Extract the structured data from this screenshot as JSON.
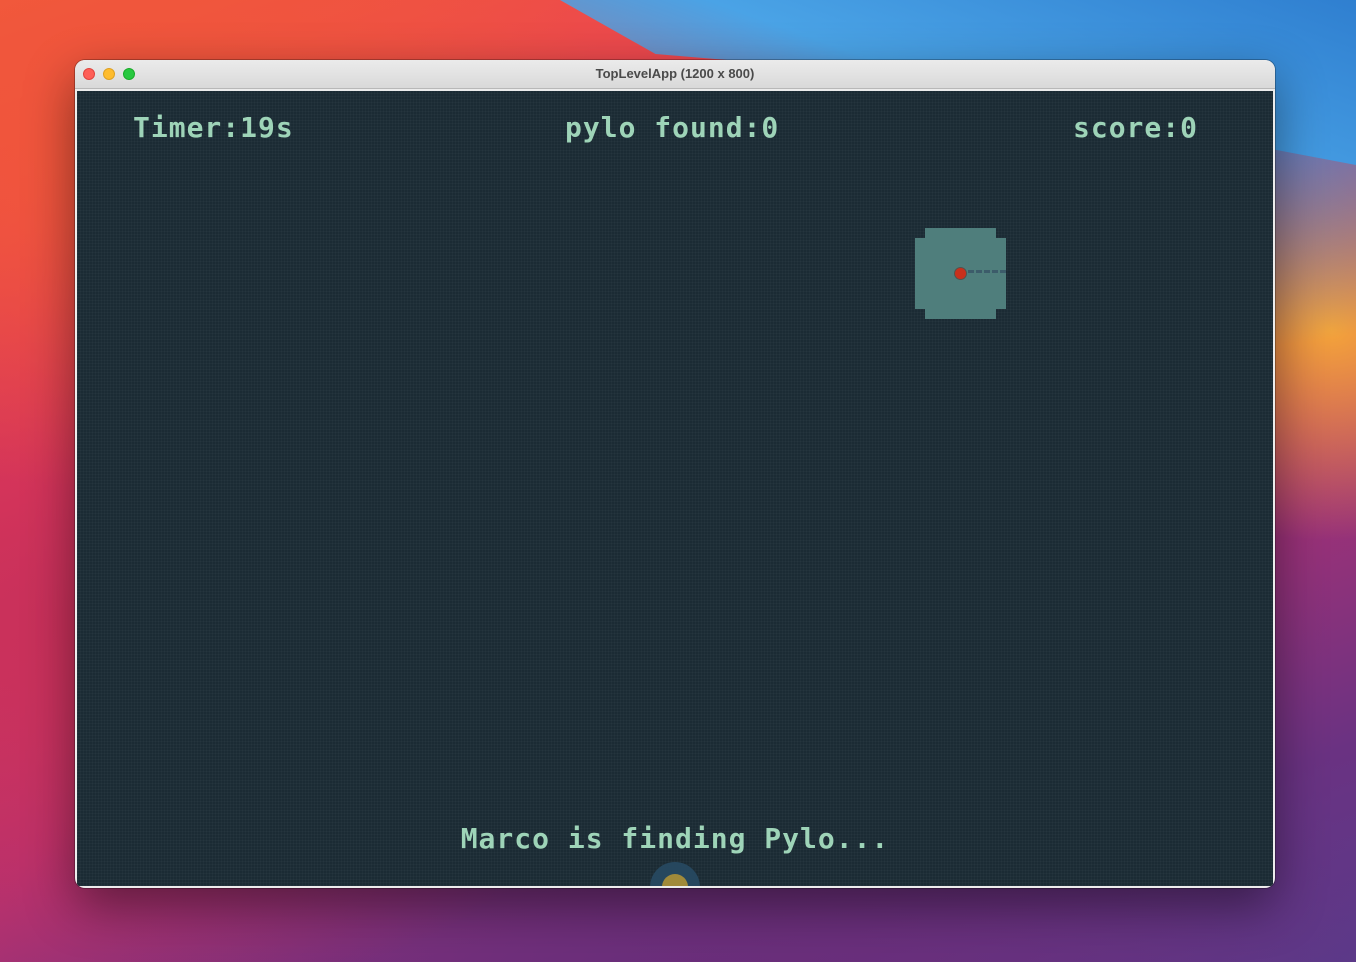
{
  "window": {
    "title": "TopLevelApp (1200 x 800)"
  },
  "hud": {
    "timer": "Timer:19s",
    "pylo_found": "pylo found:0",
    "score": "score:0"
  },
  "status": {
    "message": "Marco is finding Pylo..."
  },
  "colors": {
    "canvas_background": "#1b2b34",
    "hud_text": "#9ed4b8",
    "search_zone": "#4f7e7c",
    "marco": "#c8301c",
    "avatar": "#a08a3a"
  },
  "icons": {
    "close": "close-icon",
    "minimize": "minimize-icon",
    "maximize": "maximize-icon"
  }
}
